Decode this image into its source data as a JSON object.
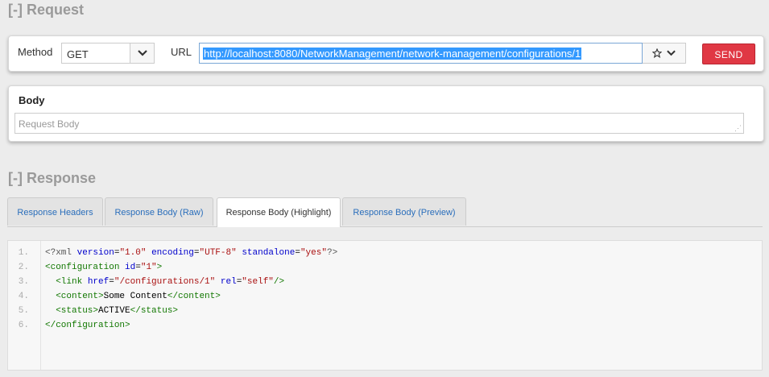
{
  "request": {
    "section_title": "[-] Request",
    "method_label": "Method",
    "method_value": "GET",
    "url_label": "URL",
    "url_value": "http://localhost:8080/NetworkManagement/network-management/configurations/1",
    "send_label": "SEND",
    "body_label": "Body",
    "body_placeholder": "Request Body"
  },
  "response": {
    "section_title": "[-] Response",
    "tabs": [
      {
        "label": "Response Headers",
        "active": false
      },
      {
        "label": "Response Body (Raw)",
        "active": false
      },
      {
        "label": "Response Body (Highlight)",
        "active": true
      },
      {
        "label": "Response Body (Preview)",
        "active": false
      }
    ],
    "line_numbers": [
      "1.",
      "2.",
      "3.",
      "4.",
      "5.",
      "6."
    ],
    "code": {
      "l1": {
        "open": "<?xml",
        "a1": "version",
        "v1": "\"1.0\"",
        "a2": "encoding",
        "v2": "\"UTF-8\"",
        "a3": "standalone",
        "v3": "\"yes\"",
        "close": "?>"
      },
      "l2": {
        "open": "<configuration",
        "a1": "id",
        "v1": "\"1\"",
        "close": ">"
      },
      "l3": {
        "open": "<link",
        "a1": "href",
        "v1": "\"/configurations/1\"",
        "a2": "rel",
        "v2": "\"self\"",
        "close": "/>"
      },
      "l4": {
        "open": "<content>",
        "text": "Some Content",
        "close": "</content>"
      },
      "l5": {
        "open": "<status>",
        "text": "ACTIVE",
        "close": "</status>"
      },
      "l6": {
        "close": "</configuration>"
      }
    }
  },
  "icons": [
    "chevron-down-icon",
    "star-icon",
    "resize-grip-icon"
  ],
  "colors": {
    "send_button": "#e03844",
    "link_tab": "#2a6ebb",
    "selection": "#3399ff"
  }
}
